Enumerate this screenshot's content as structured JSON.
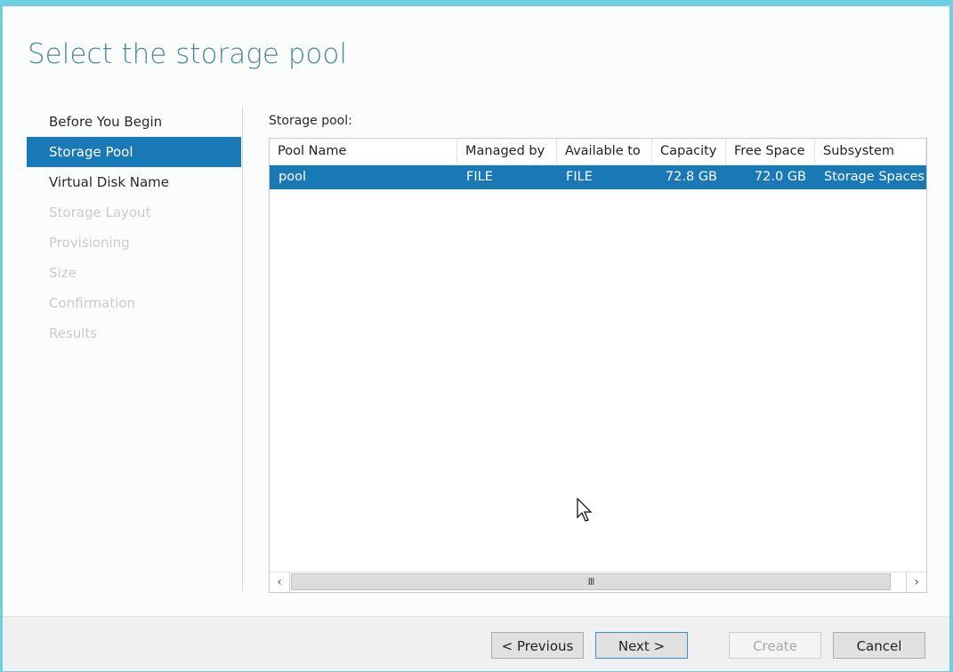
{
  "header": {
    "title": "Select the storage pool"
  },
  "sidebar": {
    "items": [
      {
        "label": "Before You Begin",
        "state": "normal"
      },
      {
        "label": "Storage Pool",
        "state": "active"
      },
      {
        "label": "Virtual Disk Name",
        "state": "normal"
      },
      {
        "label": "Storage Layout",
        "state": "disabled"
      },
      {
        "label": "Provisioning",
        "state": "disabled"
      },
      {
        "label": "Size",
        "state": "disabled"
      },
      {
        "label": "Confirmation",
        "state": "disabled"
      },
      {
        "label": "Results",
        "state": "disabled"
      }
    ]
  },
  "main": {
    "pool_label": "Storage pool:",
    "table": {
      "columns": [
        "Pool Name",
        "Managed by",
        "Available to",
        "Capacity",
        "Free Space",
        "Subsystem"
      ],
      "rows": [
        {
          "pool_name": "pool",
          "managed_by": "FILE",
          "available_to": "FILE",
          "capacity": "72.8 GB",
          "free_space": "72.0 GB",
          "subsystem": "Storage Spaces",
          "selected": true
        }
      ]
    },
    "scrollbar": {
      "left_arrow": "‹",
      "right_arrow": "›",
      "grip": "III"
    }
  },
  "footer": {
    "previous_label": "< Previous",
    "next_label": "Next >",
    "create_label": "Create",
    "cancel_label": "Cancel"
  },
  "colors": {
    "accent": "#1979b7",
    "frame": "#6cd0e2",
    "title": "#4a8a96"
  }
}
